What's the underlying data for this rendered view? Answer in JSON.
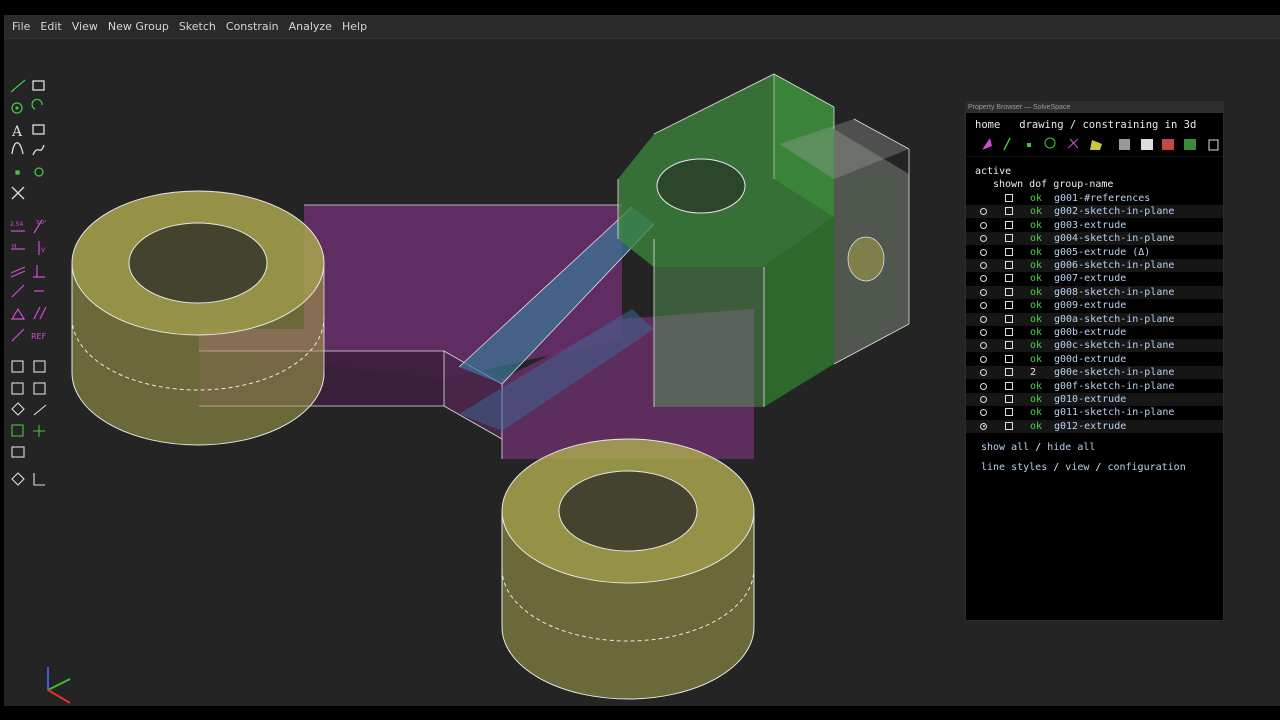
{
  "menubar": {
    "items": [
      "File",
      "Edit",
      "View",
      "New Group",
      "Sketch",
      "Constrain",
      "Analyze",
      "Help"
    ]
  },
  "toolbar_icons": [
    "line-icon",
    "rectangle-icon",
    "circle-icon",
    "arc-icon",
    "text-icon",
    "image-icon",
    "bezier-icon",
    "spline-icon",
    "point-icon",
    "tangent-arc-icon",
    "split-curves-icon",
    "distance-constraint-icon",
    "angle-constraint-icon",
    "horizontal-constraint-icon",
    "vertical-constraint-icon",
    "parallel-constraint-icon",
    "perpendicular-constraint-icon",
    "point-on-line-icon",
    "symmetric-icon",
    "equal-length-icon",
    "same-orientation-icon",
    "reference-constraint-icon",
    "workplane-icon",
    "new-sketch-icon",
    "extrude-icon",
    "lathe-icon",
    "step-translate-icon",
    "step-rotate-icon",
    "assemble-icon",
    "workplane-from-face-icon",
    "text-window-icon",
    "orthographic-icon",
    "nearest-iso-icon"
  ],
  "toolbar_labels": {
    "distance": "2.54",
    "angle": "3.0°",
    "ref": "REF",
    "h": "H",
    "v": "V"
  },
  "property_browser": {
    "title": "Property Browser — SolveSpace",
    "nav_home": "home",
    "nav_path": "drawing / constraining in 3d",
    "active_label": "active",
    "header": "shown dof group-name",
    "groups": [
      {
        "active": false,
        "radio": false,
        "dof": "ok",
        "name": "g001-#references"
      },
      {
        "active": false,
        "radio": true,
        "dof": "ok",
        "name": "g002-sketch-in-plane"
      },
      {
        "active": false,
        "radio": true,
        "dof": "ok",
        "name": "g003-extrude"
      },
      {
        "active": false,
        "radio": true,
        "dof": "ok",
        "name": "g004-sketch-in-plane"
      },
      {
        "active": false,
        "radio": true,
        "dof": "ok",
        "name": "g005-extrude (Δ)"
      },
      {
        "active": false,
        "radio": true,
        "dof": "ok",
        "name": "g006-sketch-in-plane"
      },
      {
        "active": false,
        "radio": true,
        "dof": "ok",
        "name": "g007-extrude"
      },
      {
        "active": false,
        "radio": true,
        "dof": "ok",
        "name": "g008-sketch-in-plane"
      },
      {
        "active": false,
        "radio": true,
        "dof": "ok",
        "name": "g009-extrude"
      },
      {
        "active": false,
        "radio": true,
        "dof": "ok",
        "name": "g00a-sketch-in-plane"
      },
      {
        "active": false,
        "radio": true,
        "dof": "ok",
        "name": "g00b-extrude"
      },
      {
        "active": false,
        "radio": true,
        "dof": "ok",
        "name": "g00c-sketch-in-plane"
      },
      {
        "active": false,
        "radio": true,
        "dof": "ok",
        "name": "g00d-extrude"
      },
      {
        "active": false,
        "radio": true,
        "dof": "2",
        "name": "g00e-sketch-in-plane"
      },
      {
        "active": false,
        "radio": true,
        "dof": "ok",
        "name": "g00f-sketch-in-plane"
      },
      {
        "active": false,
        "radio": true,
        "dof": "ok",
        "name": "g010-extrude"
      },
      {
        "active": false,
        "radio": true,
        "dof": "ok",
        "name": "g011-sketch-in-plane"
      },
      {
        "active": true,
        "radio": true,
        "dof": "ok",
        "name": "g012-extrude"
      }
    ],
    "show_all": "show all",
    "sep": " / ",
    "hide_all": "hide all",
    "line_styles": "line styles",
    "view": "view",
    "configuration": "configuration"
  },
  "colors": {
    "background": "#242424",
    "solid_yellow": "#a5a34a",
    "solid_green": "#3c8a3c",
    "solid_purple": "#7a3a7c",
    "solid_blue": "#3f7fa0",
    "ok_green": "#4bd14b",
    "link": "#b9d2f0",
    "constraint_magenta": "#d24dd2",
    "sketch_green": "#43c643"
  }
}
